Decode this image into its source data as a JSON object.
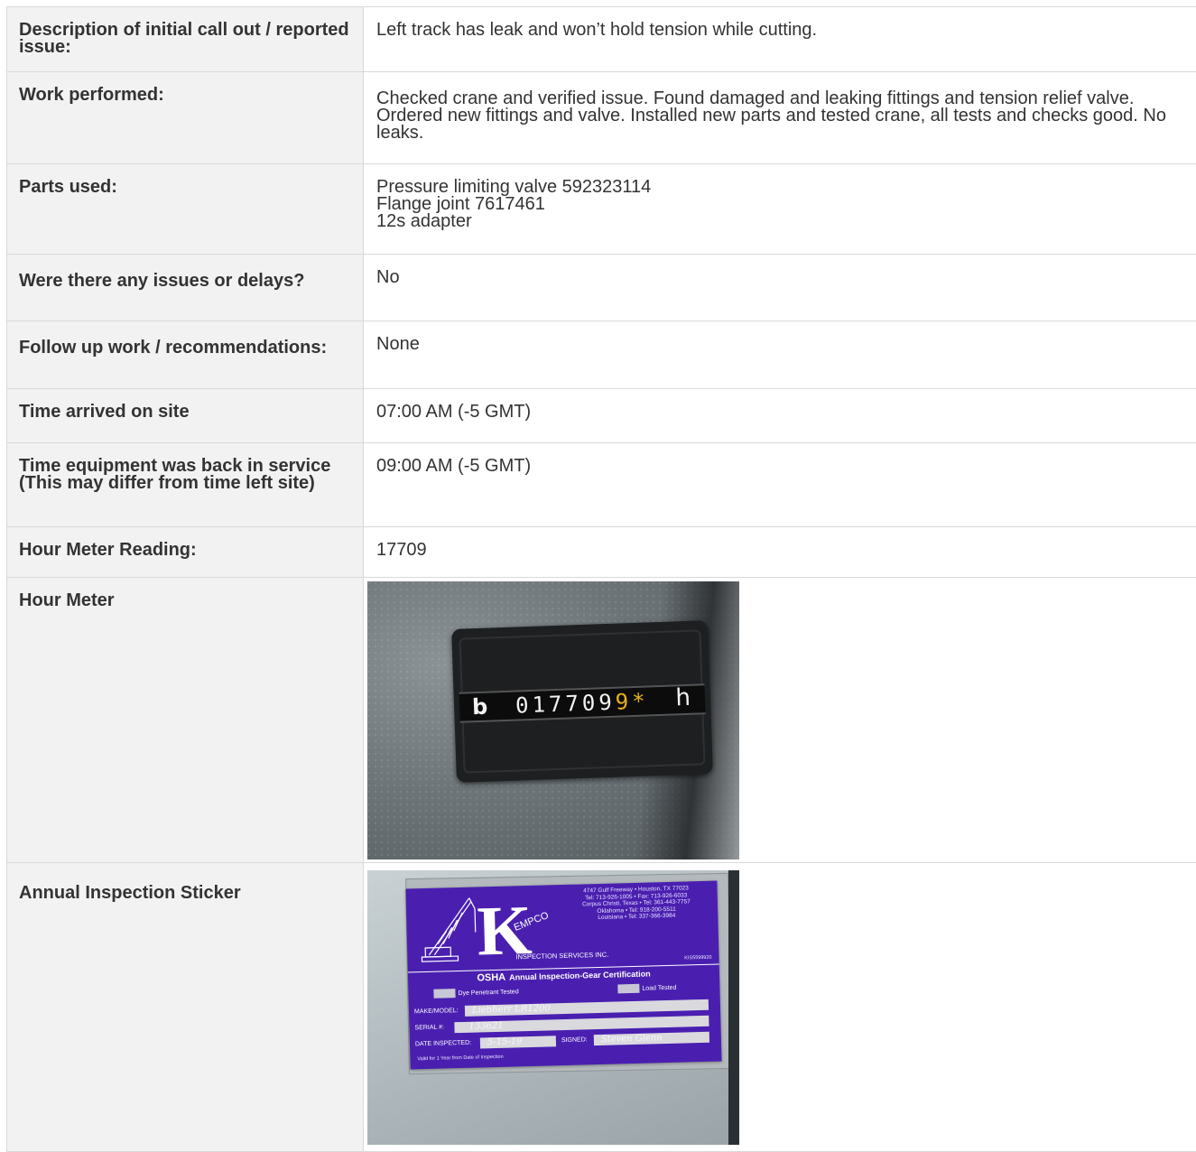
{
  "rows": [
    {
      "label": "Description of initial call out / reported issue:",
      "value": "Left track has leak and won’t hold tension while cutting."
    },
    {
      "label": "Work performed:",
      "value": "Checked crane and verified issue. Found damaged and leaking fittings and tension relief valve. Ordered new fittings and valve. Installed new parts and tested crane, all tests and checks good. No leaks."
    },
    {
      "label": "Parts used:",
      "value_lines": [
        "Pressure limiting valve 592323114",
        "Flange joint 7617461",
        "12s adapter"
      ]
    },
    {
      "label": "Were there any issues or delays?",
      "value": "No"
    },
    {
      "label": "Follow up work / recommendations:",
      "value": "None"
    },
    {
      "label": "Time arrived on site",
      "value": "07:00 AM (-5 GMT)"
    },
    {
      "label": "Time equipment was back in service (This may differ from time left site)",
      "value": "09:00 AM (-5 GMT)"
    },
    {
      "label": "Hour Meter Reading:",
      "value": "17709"
    },
    {
      "label": "Hour Meter"
    },
    {
      "label": "Annual Inspection Sticker"
    }
  ],
  "hour_meter_photo": {
    "prefix": "b",
    "digits": "017709",
    "star": "9*",
    "unit": "h"
  },
  "sticker_photo": {
    "address_lines": [
      "4747 Gulf Freeway • Houston, TX 77023",
      "Tel: 713-926-1005 • Fax: 713-926-6033",
      "Corpus Christi, Texas • Tel: 361-443-7757",
      "Oklahoma • Tel: 918-200-5511",
      "Louisiana • Tel: 337-366-3984"
    ],
    "logo_letter": "K",
    "logo_rest": "EMPCO",
    "services": "INSPECTION SERVICES INC.",
    "code": "KIS5599920",
    "osha": "OSHA",
    "certification": "Annual Inspection-Gear Certification",
    "check1": "Dye Penetrant Tested",
    "check2": "Load Tested",
    "make_label": "MAKE/MODEL:",
    "make_value": "Liebherr   LR1200",
    "serial_label": "SERIAL #:",
    "serial_value": "133621",
    "date_label": "DATE INSPECTED:",
    "date_value": "5-15-19",
    "signed_label": "SIGNED:",
    "signed_value": "Steven Glenn",
    "valid": "Valid for 1 Year from Date of Inspection"
  }
}
